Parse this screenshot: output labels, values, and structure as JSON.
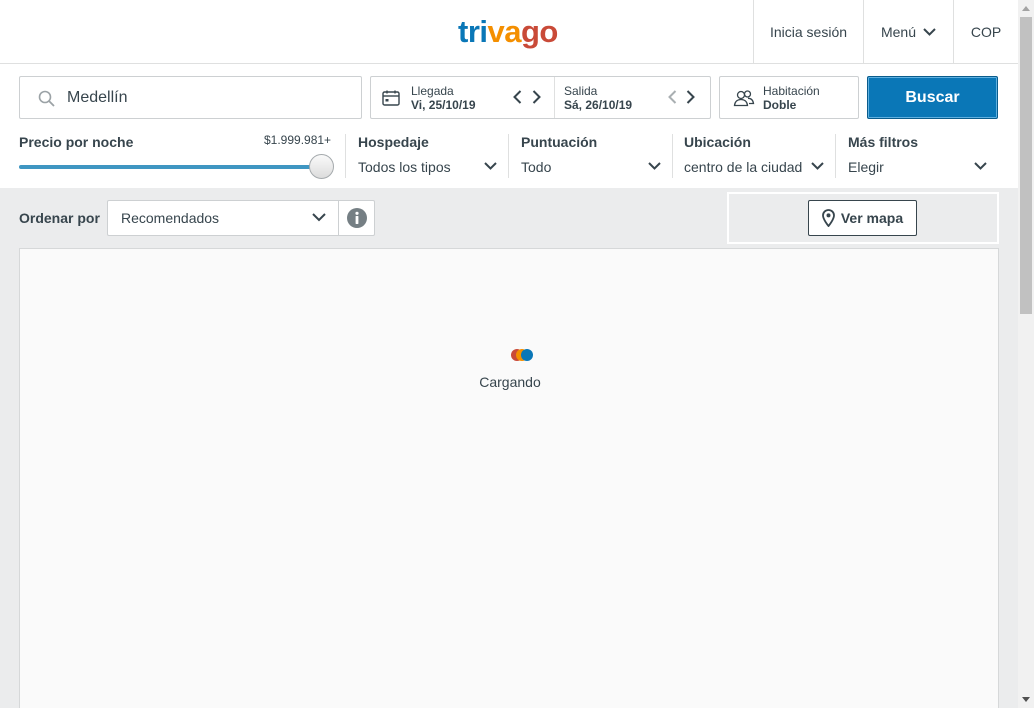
{
  "header": {
    "logo": {
      "part1": "tri",
      "part2": "va",
      "part3": "go"
    },
    "login": "Inicia sesión",
    "menu": "Menú",
    "currency": "COP"
  },
  "search": {
    "destination": "Medellín",
    "checkin": {
      "label": "Llegada",
      "value": "Vi, 25/10/19"
    },
    "checkout": {
      "label": "Salida",
      "value": "Sá, 26/10/19"
    },
    "room": {
      "label": "Habitación",
      "value": "Doble"
    },
    "button": "Buscar"
  },
  "filters": {
    "price": {
      "label": "Precio por noche",
      "max": "$1.999.981+",
      "level_fraction": 1.0
    },
    "lodging": {
      "label": "Hospedaje",
      "value": "Todos los tipos"
    },
    "rating": {
      "label": "Puntuación",
      "value": "Todo"
    },
    "location": {
      "label": "Ubicación",
      "value": "centro de la ciudad"
    },
    "more": {
      "label": "Más filtros",
      "value": "Elegir"
    }
  },
  "sort": {
    "label": "Ordenar por",
    "value": "Recomendados"
  },
  "map_button": "Ver mapa",
  "results": {
    "loading_text": "Cargando"
  },
  "colors": {
    "brand_blue": "#0a77b7",
    "brand_orange": "#f48f00",
    "brand_red": "#c94a38",
    "text": "#37454d"
  },
  "icons": [
    "search-icon",
    "calendar-icon",
    "chevron-left-icon",
    "chevron-right-icon",
    "people-icon",
    "chevron-down-icon",
    "info-icon",
    "map-pin-icon"
  ]
}
